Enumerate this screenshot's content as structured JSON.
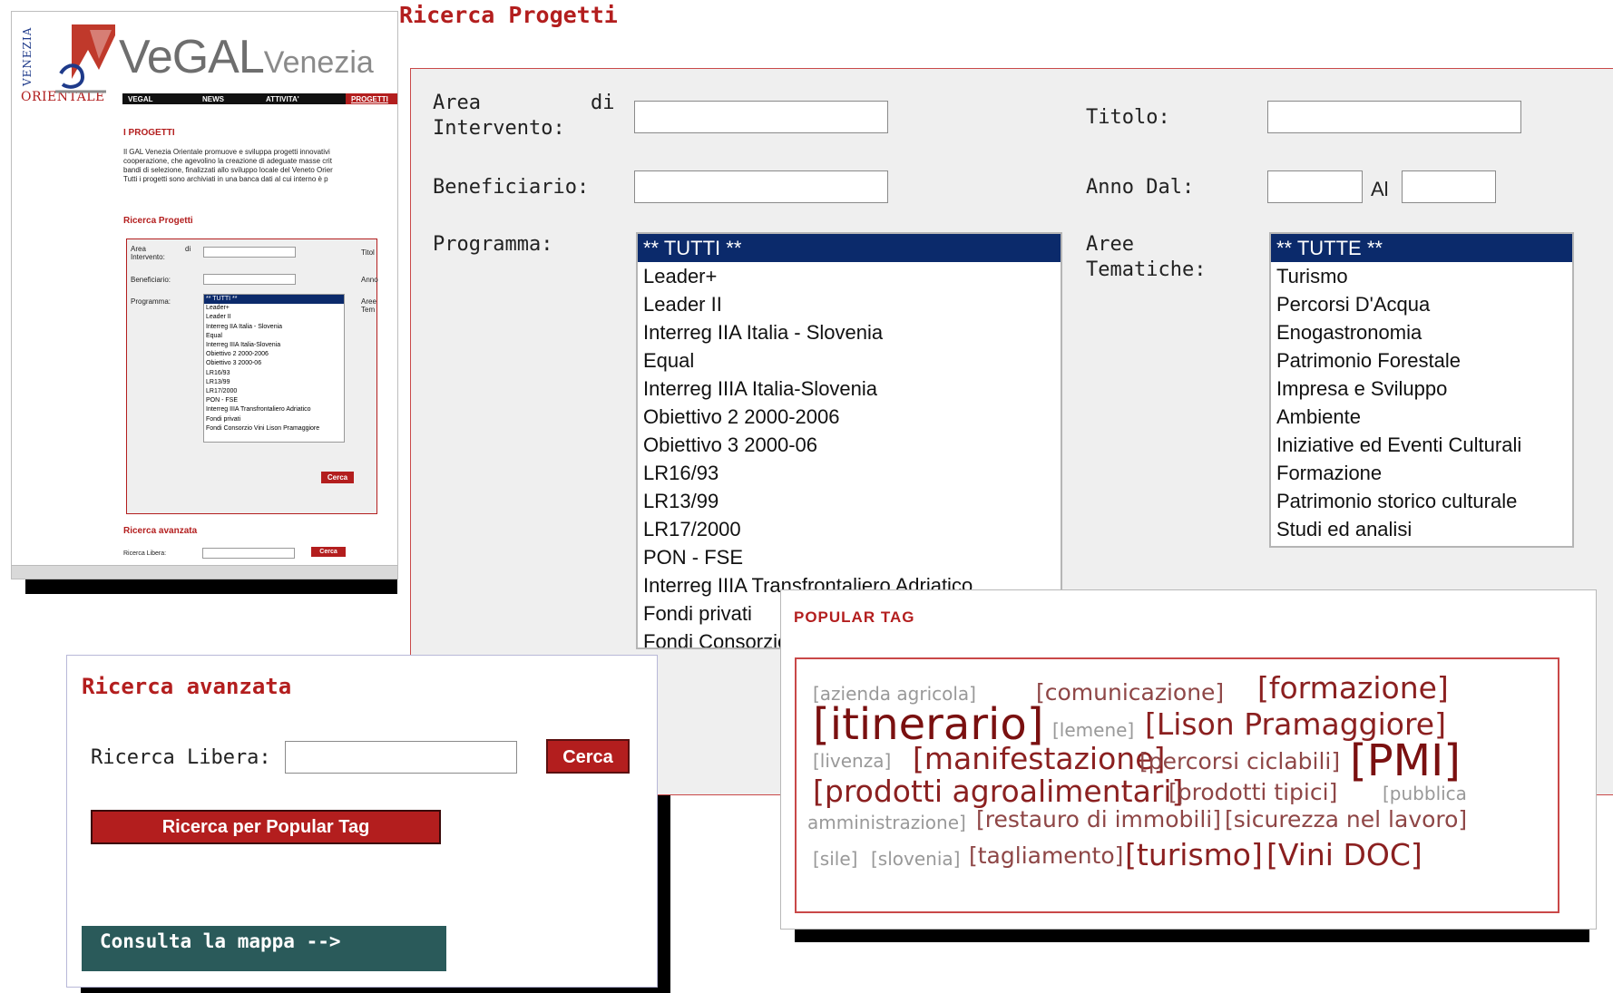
{
  "site": {
    "logo_vertical": "VENEZIA",
    "logo_orientale": "ORIENTALE",
    "brand_main": "VeGAL",
    "brand_sub": "Venezia",
    "nav": [
      "VEGAL",
      "NEWS",
      "ATTIVITA'",
      "PROGETTI"
    ],
    "section_projects": "I PROGETTI",
    "intro_lines": [
      "Il GAL Venezia Orientale promuove e sviluppa progetti innovativi",
      "cooperazione, che agevolino la creazione di adeguate masse crit",
      "bandi di selezione, finalizzati allo sviluppo locale del Veneto Orier",
      "Tutti i progetti sono archiviati in una banca dati al cui interno è p"
    ],
    "section_search": "Ricerca Progetti",
    "mini_area_label": "Area\nIntervento:",
    "mini_di": "di",
    "mini_titolo": "Titol",
    "mini_beneficiario": "Beneficiario:",
    "mini_anno": "Anno",
    "mini_programma": "Programma:",
    "mini_aree": "Aree\nTem",
    "mini_programs": [
      "** TUTTI **",
      "Leader+",
      "Leader II",
      "Interreg IIA Italia - Slovenia",
      "Equal",
      "Interreg IIIA Italia-Slovenia",
      "Obiettivo 2 2000-2006",
      "Obiettivo 3 2000-06",
      "LR16/93",
      "LR13/99",
      "LR17/2000",
      "PON - FSE",
      "Interreg IIIA Transfrontaliero Adriatico",
      "Fondi privati",
      "Fondi Consorzio Vini Lison Pramaggiore"
    ],
    "mini_cerca": "Cerca",
    "section_advanced": "Ricerca avanzata",
    "mini_ricerca_libera": "Ricerca Libera:",
    "mini_cerca2": "Cerca"
  },
  "form": {
    "title": "Ricerca Progetti",
    "area_label_line1": "Area",
    "area_label_di": "di",
    "area_label_line2": "Intervento:",
    "titolo_label": "Titolo:",
    "beneficiario_label": "Beneficiario:",
    "anno_dal_label": "Anno Dal:",
    "al_label": "Al",
    "programma_label": "Programma:",
    "aree_label_line1": "Aree",
    "aree_label_line2": "Tematiche:",
    "programs": [
      "** TUTTI **",
      "Leader+",
      "Leader II",
      "Interreg IIA Italia - Slovenia",
      "Equal",
      "Interreg IIIA Italia-Slovenia",
      "Obiettivo 2 2000-2006",
      "Obiettivo 3 2000-06",
      "LR16/93",
      "LR13/99",
      "LR17/2000",
      "PON - FSE",
      "Interreg IIIA Transfrontaliero Adriatico",
      "Fondi privati",
      "Fondi Consorzio Vini Lison Pramaggiore"
    ],
    "themes": [
      "** TUTTE **",
      "Turismo",
      "Percorsi D'Acqua",
      "Enogastronomia",
      "Patrimonio Forestale",
      "Impresa e Sviluppo",
      "Ambiente",
      "Iniziative ed Eventi Culturali",
      "Formazione",
      "Patrimonio storico culturale",
      "Studi ed analisi"
    ],
    "selected_program": "** TUTTI **",
    "selected_theme": "** TUTTE **"
  },
  "advanced": {
    "title": "Ricerca avanzata",
    "free_search_label": "Ricerca Libera:",
    "free_search_value": "",
    "search_button": "Cerca",
    "popular_tag_button": "Ricerca per Popular Tag",
    "map_button": "Consulta la mappa -->"
  },
  "popular": {
    "title": "POPULAR TAG",
    "tags": [
      {
        "text": "[azienda  agricola]",
        "size": "s1"
      },
      {
        "text": "[comunicazione]",
        "size": "s2"
      },
      {
        "text": "[formazione]",
        "size": "s3"
      },
      {
        "text": "[itinerario]",
        "size": "s4"
      },
      {
        "text": "[lemene]",
        "size": "s1"
      },
      {
        "text": "[Lison Pramaggiore]",
        "size": "s3"
      },
      {
        "text": "[livenza]",
        "size": "s1"
      },
      {
        "text": "[manifestazione]",
        "size": "s3"
      },
      {
        "text": "[percorsi  ciclabili]",
        "size": "s2"
      },
      {
        "text": "[PMI]",
        "size": "s4"
      },
      {
        "text": "[prodotti  agroalimentari]",
        "size": "s3"
      },
      {
        "text": "[prodotti  tipici]",
        "size": "s2"
      },
      {
        "text": "[pubblica",
        "size": "s1"
      },
      {
        "text": "amministrazione]",
        "size": "s1"
      },
      {
        "text": "[restauro di immobili]",
        "size": "s2"
      },
      {
        "text": "[sicurezza nel lavoro]",
        "size": "s2"
      },
      {
        "text": "[sile]",
        "size": "s1"
      },
      {
        "text": "[slovenia]",
        "size": "s1"
      },
      {
        "text": "[tagliamento]",
        "size": "s2"
      },
      {
        "text": "[turismo]",
        "size": "s3"
      },
      {
        "text": "[Vini DOC]",
        "size": "s3"
      }
    ]
  },
  "colors": {
    "accent_red": "#b31e1e",
    "selected_blue": "#0b2a6b",
    "map_button": "#2a5a5a",
    "panel_grey": "#efefef"
  }
}
